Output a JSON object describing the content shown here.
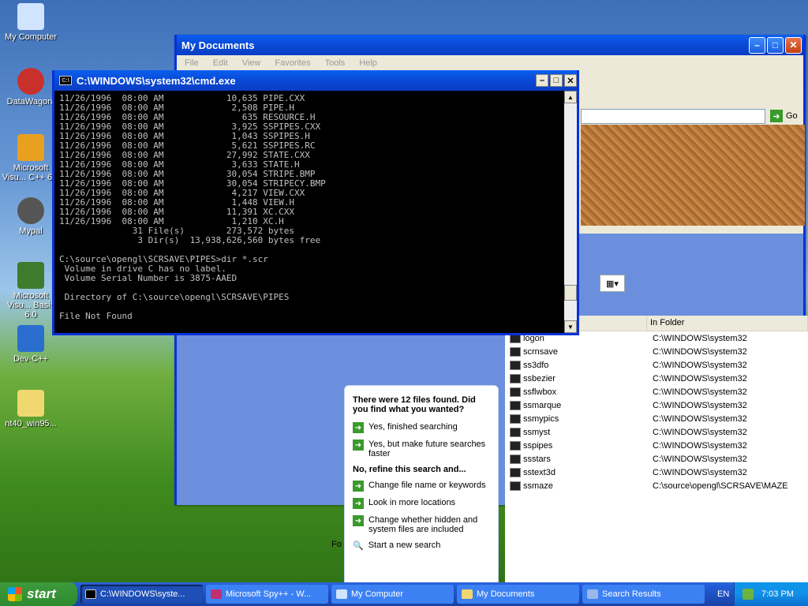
{
  "desktop_icons": [
    {
      "label": "My Computer",
      "icon": "computer-icon",
      "color": "#d0e4ff"
    },
    {
      "label": "DataWagon.",
      "icon": "datawagon-icon",
      "color": "#c9302c"
    },
    {
      "label": "Microsoft Visu... C++ 6.0",
      "icon": "msvc-icon",
      "color": "#e8a020"
    },
    {
      "label": "Mypal",
      "icon": "mypal-icon",
      "color": "#555"
    },
    {
      "label": "Microsoft Visu... Basic 6.0",
      "icon": "vb-icon",
      "color": "#3d7c2c"
    },
    {
      "label": "Dev-C++",
      "icon": "devcpp-icon",
      "color": "#2a6ed0"
    },
    {
      "label": "nt40_win95...",
      "icon": "iso-folder-icon",
      "color": "#f0d770"
    }
  ],
  "mydocs": {
    "title": "My Documents",
    "menu": [
      "File",
      "Edit",
      "View",
      "Favorites",
      "Tools",
      "Help"
    ],
    "go_label": "Go"
  },
  "cmd": {
    "title": "C:\\WINDOWS\\system32\\cmd.exe",
    "lines": [
      "11/26/1996  08:00 AM            10,635 PIPE.CXX",
      "11/26/1996  08:00 AM             2,508 PIPE.H",
      "11/26/1996  08:00 AM               635 RESOURCE.H",
      "11/26/1996  08:00 AM             3,925 SSPIPES.CXX",
      "11/26/1996  08:00 AM             1,043 SSPIPES.H",
      "11/26/1996  08:00 AM             5,621 SSPIPES.RC",
      "11/26/1996  08:00 AM            27,992 STATE.CXX",
      "11/26/1996  08:00 AM             3,633 STATE.H",
      "11/26/1996  08:00 AM            30,054 STRIPE.BMP",
      "11/26/1996  08:00 AM            30,054 STRIPECY.BMP",
      "11/26/1996  08:00 AM             4,217 VIEW.CXX",
      "11/26/1996  08:00 AM             1,448 VIEW.H",
      "11/26/1996  08:00 AM            11,391 XC.CXX",
      "11/26/1996  08:00 AM             1,210 XC.H",
      "              31 File(s)        273,572 bytes",
      "               3 Dir(s)  13,938,626,560 bytes free",
      "",
      "C:\\source\\opengl\\SCRSAVE\\PIPES>dir *.scr",
      " Volume in drive C has no label.",
      " Volume Serial Number is 3875-AAED",
      "",
      " Directory of C:\\source\\opengl\\SCRSAVE\\PIPES",
      "",
      "File Not Found"
    ]
  },
  "search_panel": {
    "summary": "There were 12 files found. Did you find what you wanted?",
    "options": [
      "Yes, finished searching",
      "Yes, but make future searches faster"
    ],
    "refine_heading": "No, refine this search and...",
    "refine_options": [
      "Change file name or keywords",
      "Look in more locations",
      "Change whether hidden and system files are included"
    ],
    "new_search": "Start a new search"
  },
  "results": {
    "column_in_folder": "In Folder",
    "rows": [
      {
        "name": "logon",
        "folder": "C:\\WINDOWS\\system32"
      },
      {
        "name": "scrnsave",
        "folder": "C:\\WINDOWS\\system32"
      },
      {
        "name": "ss3dfo",
        "folder": "C:\\WINDOWS\\system32"
      },
      {
        "name": "ssbezier",
        "folder": "C:\\WINDOWS\\system32"
      },
      {
        "name": "ssflwbox",
        "folder": "C:\\WINDOWS\\system32"
      },
      {
        "name": "ssmarque",
        "folder": "C:\\WINDOWS\\system32"
      },
      {
        "name": "ssmypics",
        "folder": "C:\\WINDOWS\\system32"
      },
      {
        "name": "ssmyst",
        "folder": "C:\\WINDOWS\\system32"
      },
      {
        "name": "sspipes",
        "folder": "C:\\WINDOWS\\system32"
      },
      {
        "name": "ssstars",
        "folder": "C:\\WINDOWS\\system32"
      },
      {
        "name": "sstext3d",
        "folder": "C:\\WINDOWS\\system32"
      },
      {
        "name": "ssmaze",
        "folder": "C:\\source\\opengl\\SCRSAVE\\MAZE"
      }
    ]
  },
  "taskbar": {
    "start": "start",
    "tasks": [
      {
        "label": "C:\\WINDOWS\\syste...",
        "active": true
      },
      {
        "label": "Microsoft Spy++ - W...",
        "active": false
      },
      {
        "label": "My Computer",
        "active": false
      },
      {
        "label": "My Documents",
        "active": false
      },
      {
        "label": "Search Results",
        "active": false
      }
    ],
    "lang": "EN",
    "clock": "7:03 PM"
  }
}
